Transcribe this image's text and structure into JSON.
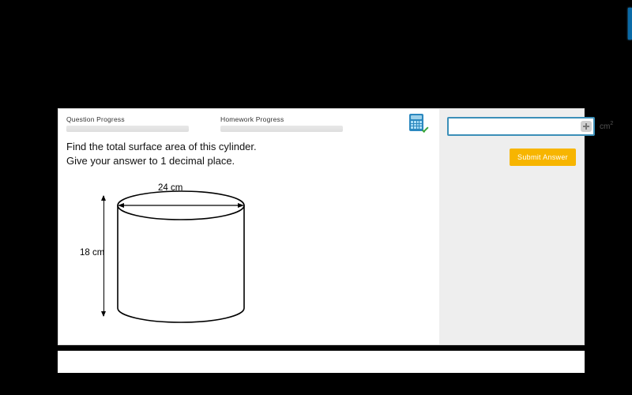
{
  "progress": {
    "question_label": "Question Progress",
    "homework_label": "Homework Progress"
  },
  "question": {
    "line1": "Find the total surface area of this cylinder.",
    "line2": "Give your answer to 1 decimal place."
  },
  "diagram": {
    "diameter_label": "24 cm",
    "height_label": "18 cm",
    "diameter_value": 24,
    "height_value": 18
  },
  "answer": {
    "value": "",
    "unit_base": "cm",
    "unit_exp": "2",
    "submit_label": "Submit Answer"
  }
}
